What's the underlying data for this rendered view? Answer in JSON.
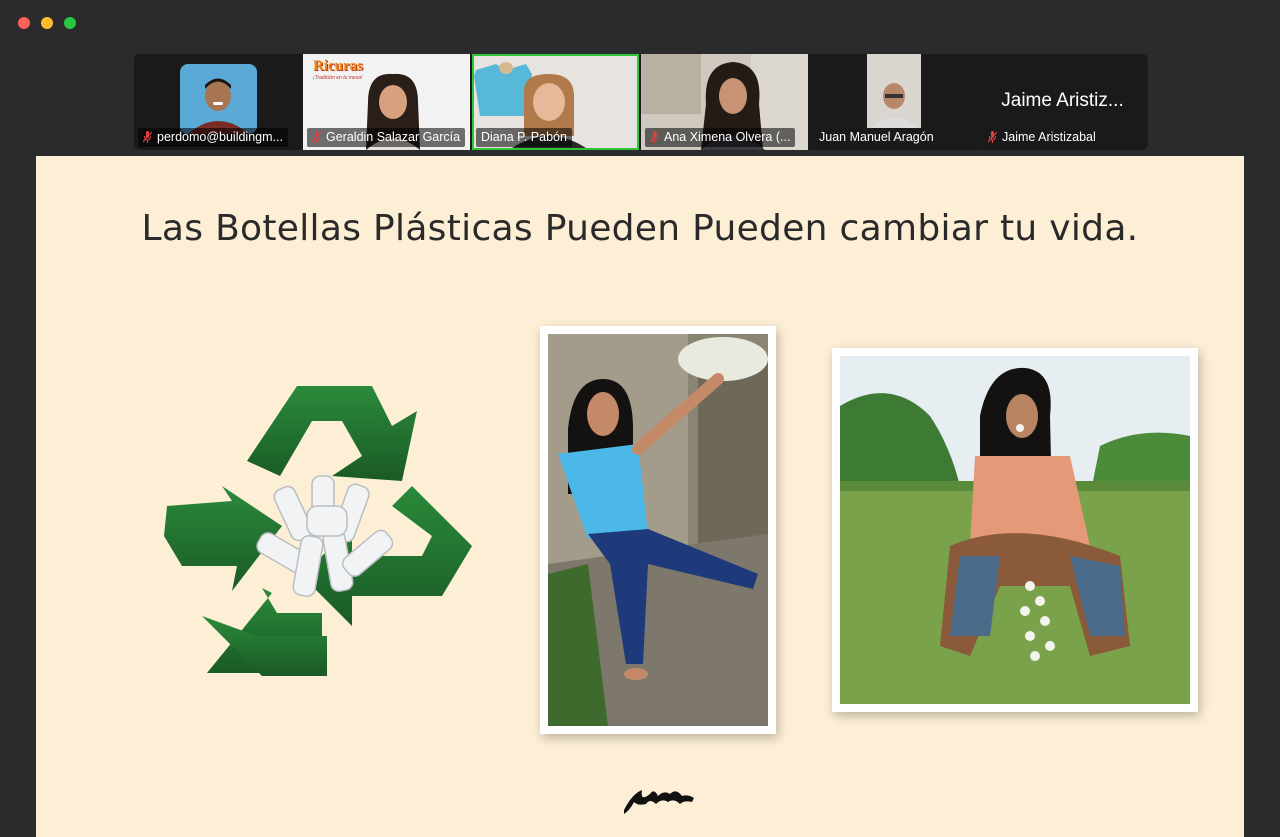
{
  "participants": [
    {
      "name": "perdomo@buildingm...",
      "muted": true
    },
    {
      "name": "Geraldin Salazar García",
      "muted": true,
      "logo_text": "Ricuras",
      "logo_tagline": "¡Tradición en tu mesa!"
    },
    {
      "name": "Diana P. Pabón",
      "muted": false,
      "active": true
    },
    {
      "name": "Ana Ximena Olvera (...",
      "muted": true
    },
    {
      "name": "Juan Manuel Aragón",
      "muted": false
    },
    {
      "name": "Jaime Aristizabal",
      "muted": true,
      "display_name": "Jaime Aristiz..."
    }
  ],
  "slide": {
    "title": "Las Botellas Plásticas Pueden Pueden cambiar tu vida."
  },
  "colors": {
    "slide_bg": "#fdefd6",
    "recycle_green": "#1f6a2d",
    "active_speaker": "#2fc43a"
  }
}
